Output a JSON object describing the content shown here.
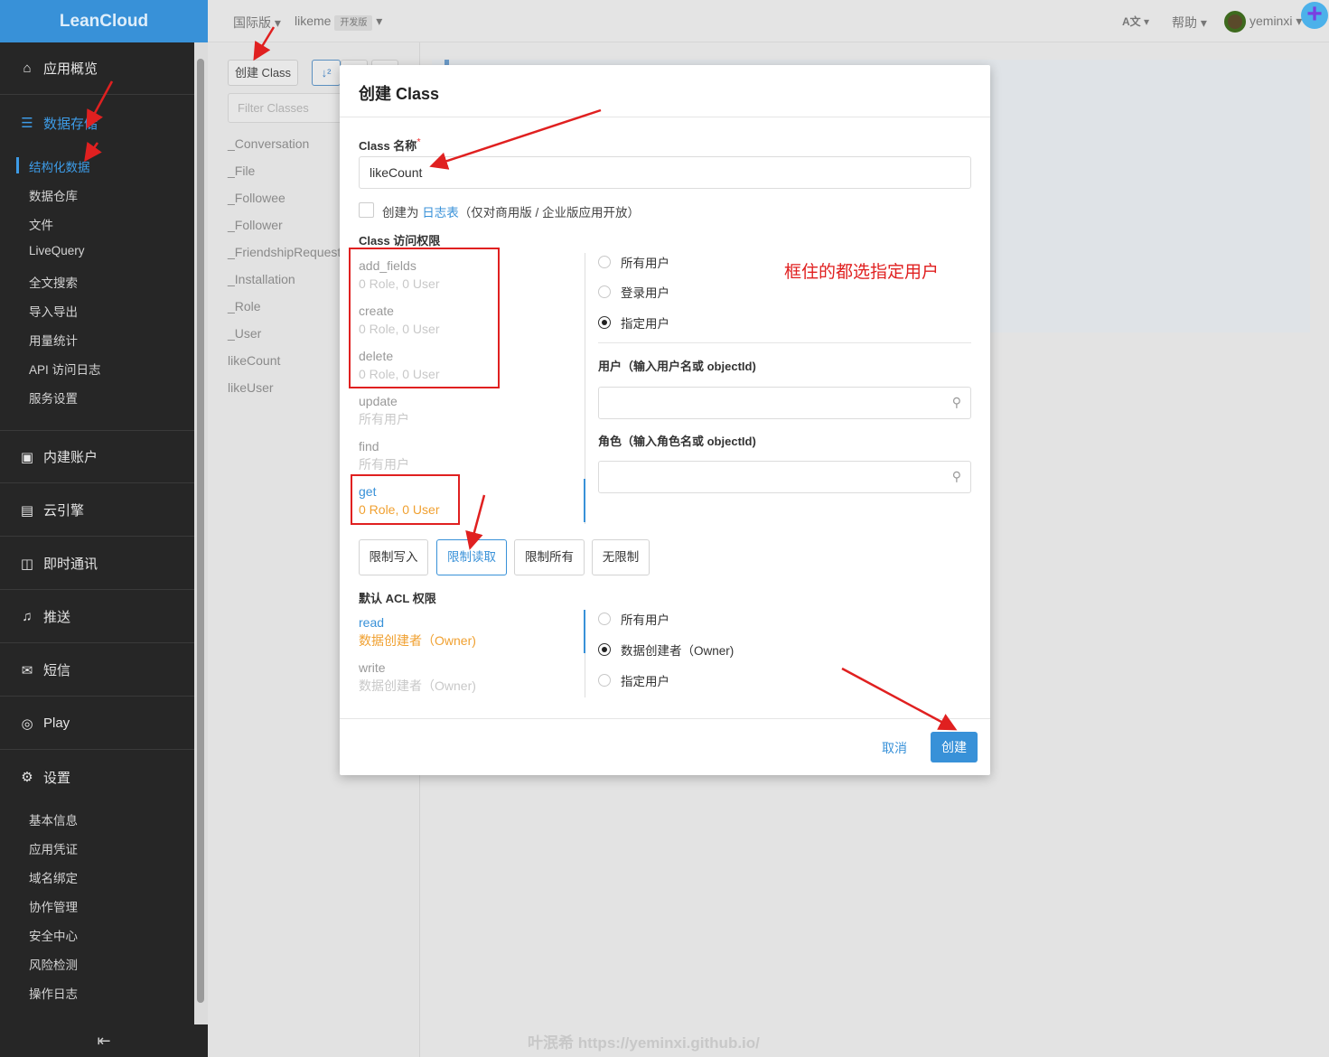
{
  "brand": "LeanCloud",
  "sidebar": {
    "sections": [
      {
        "label": "应用概览",
        "icon": "home-icon"
      },
      {
        "label": "数据存储",
        "icon": "database-icon",
        "active": true
      },
      {
        "label": "内建账户",
        "icon": "user-card-icon"
      },
      {
        "label": "云引擎",
        "icon": "server-icon"
      },
      {
        "label": "即时通讯",
        "icon": "chat-icon"
      },
      {
        "label": "推送",
        "icon": "bell-icon"
      },
      {
        "label": "短信",
        "icon": "mail-icon"
      },
      {
        "label": "Play",
        "icon": "gamepad-icon"
      },
      {
        "label": "设置",
        "icon": "gear-icon"
      }
    ],
    "storage_items": [
      "结构化数据",
      "数据仓库",
      "文件",
      "LiveQuery",
      "全文搜索",
      "导入导出",
      "用量统计",
      "API 访问日志",
      "服务设置"
    ],
    "settings_items": [
      "基本信息",
      "应用凭证",
      "域名绑定",
      "协作管理",
      "安全中心",
      "风险检测",
      "操作日志"
    ],
    "collapse_icon": "collapse-left-icon"
  },
  "topbar": {
    "region": "国际版",
    "app": "likeme",
    "app_badge": "开发版",
    "lang_icon": "language-icon",
    "help": "帮助",
    "user": "yeminxi"
  },
  "class_panel": {
    "create_button": "创建 Class",
    "filter_placeholder": "Filter Classes",
    "classes": [
      "_Conversation",
      "_File",
      "_Followee",
      "_Follower",
      "_FriendshipRequest",
      "_Installation",
      "_Role",
      "_User",
      "likeCount",
      "likeUser"
    ]
  },
  "modal": {
    "title": "创建 Class",
    "name_label": "Class 名称",
    "required_mark": "*",
    "name_value": "likeCount",
    "log_prefix": "创建为",
    "log_link": "日志表",
    "log_suffix": "（仅对商用版 / 企业版应用开放）",
    "access_label": "Class 访问权限",
    "permissions": [
      {
        "name": "add_fields",
        "value": "0 Role, 0 User"
      },
      {
        "name": "create",
        "value": "0 Role, 0 User"
      },
      {
        "name": "delete",
        "value": "0 Role, 0 User"
      },
      {
        "name": "update",
        "value": "所有用户"
      },
      {
        "name": "find",
        "value": "所有用户"
      },
      {
        "name": "get",
        "value": "0 Role, 0 User"
      }
    ],
    "radios": [
      "所有用户",
      "登录用户",
      "指定用户"
    ],
    "selected_radio": "指定用户",
    "user_label": "用户（输入用户名或 objectId)",
    "role_label": "角色（输入角色名或 objectId)",
    "presets": [
      "限制写入",
      "限制读取",
      "限制所有",
      "无限制"
    ],
    "active_preset": "限制读取",
    "acl_label": "默认 ACL 权限",
    "acl": [
      {
        "name": "read",
        "value": "数据创建者（Owner)"
      },
      {
        "name": "write",
        "value": "数据创建者（Owner)"
      }
    ],
    "acl_radios": [
      "所有用户",
      "数据创建者（Owner)",
      "指定用户"
    ],
    "acl_selected": "数据创建者（Owner)",
    "cancel": "取消",
    "create": "创建"
  },
  "annotation": "框住的都选指定用户",
  "watermark": "叶泯希 https://yeminxi.github.io/",
  "colors": {
    "accent": "#3891d8",
    "annotation": "#e02020",
    "orange": "#f0a030"
  }
}
